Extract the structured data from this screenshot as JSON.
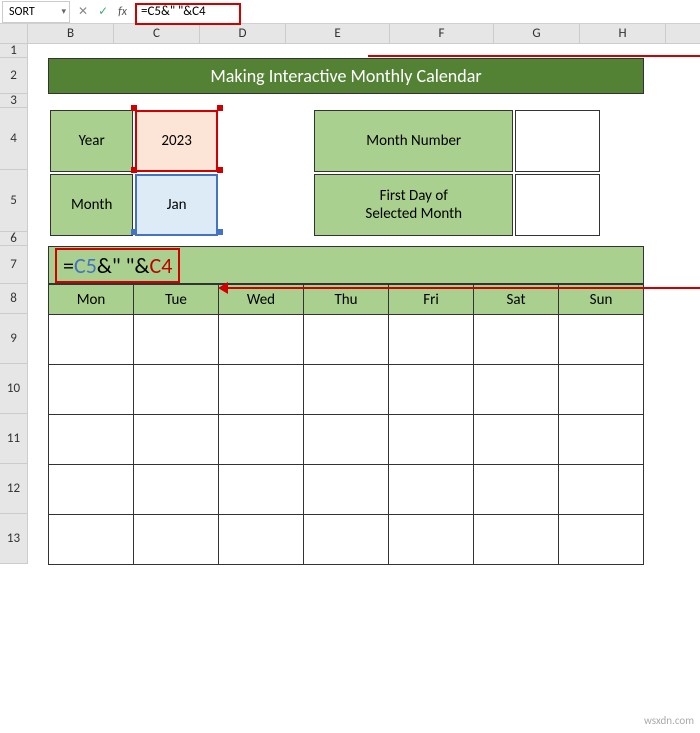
{
  "formula_bar": {
    "name_box": "SORT",
    "formula": "=C5&\" \"&C4"
  },
  "columns": [
    "B",
    "C",
    "D",
    "E",
    "F",
    "G",
    "H"
  ],
  "rows": [
    "1",
    "2",
    "3",
    "4",
    "5",
    "6",
    "7",
    "8",
    "9",
    "10",
    "11",
    "12",
    "13"
  ],
  "title": "Making Interactive Monthly Calendar",
  "params": {
    "year_label": "Year",
    "year_value": "2023",
    "month_label": "Month",
    "month_value": "Jan"
  },
  "info": {
    "month_num_label": "Month Number",
    "month_num_value": "",
    "first_day_label_l1": "First Day of",
    "first_day_label_l2": "Selected Month",
    "first_day_value": ""
  },
  "formula_cell": {
    "eq": "=",
    "c5": "C5",
    "amp1": "&",
    "str": "\" \"",
    "amp2": "&",
    "c4": "C4"
  },
  "weekdays": [
    "Mon",
    "Tue",
    "Wed",
    "Thu",
    "Fri",
    "Sat",
    "Sun"
  ],
  "watermark": "wsxdn.com"
}
